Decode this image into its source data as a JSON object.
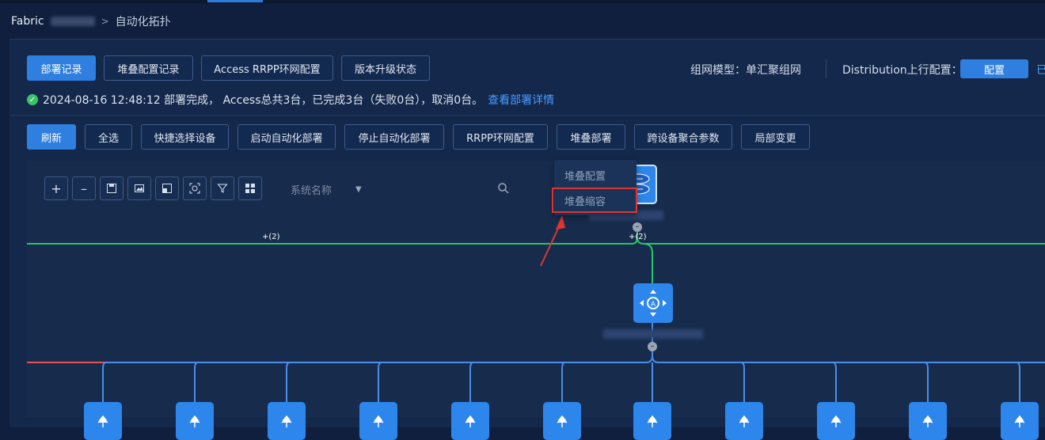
{
  "breadcrumb": {
    "root": "Fabric",
    "separator": ">",
    "current": "自动化拓扑"
  },
  "top_buttons": [
    "部署记录",
    "堆叠配置记录",
    "Access RRPP环网配置",
    "版本升级状态"
  ],
  "network_model": {
    "label": "组网模型：单汇聚组网"
  },
  "distribution": {
    "label": "Distribution上行配置：",
    "button": "配置",
    "trailing": "已"
  },
  "status": {
    "text": "2024-08-16 12:48:12 部署完成， Access总共3台，已完成3台（失败0台），取消0台。",
    "link": "查看部署详情"
  },
  "action_buttons": [
    "刷新",
    "全选",
    "快捷选择设备",
    "启动自动化部署",
    "停止自动化部署",
    "RRPP环网配置",
    "堆叠部署",
    "跨设备聚合参数",
    "局部变更"
  ],
  "toolbar": {
    "tools": [
      "plus-icon",
      "minus-icon",
      "save-icon",
      "image-icon",
      "fit-icon",
      "focus-icon",
      "filter-icon",
      "grid-icon"
    ],
    "zoom_in": "+",
    "zoom_out": "–",
    "search_placeholder": "系统名称"
  },
  "stack_menu": {
    "items": [
      "堆叠配置",
      "堆叠缩容"
    ]
  },
  "topology": {
    "left_count": "+(2)",
    "right_count": "+(2)",
    "access_count": 11
  },
  "colors": {
    "primary": "#2f7fe0",
    "link": "#4a9bff",
    "green_link": "#27c46d",
    "blue_link": "#4a8eea",
    "red_link": "#e25353",
    "highlight": "#e0352e"
  }
}
